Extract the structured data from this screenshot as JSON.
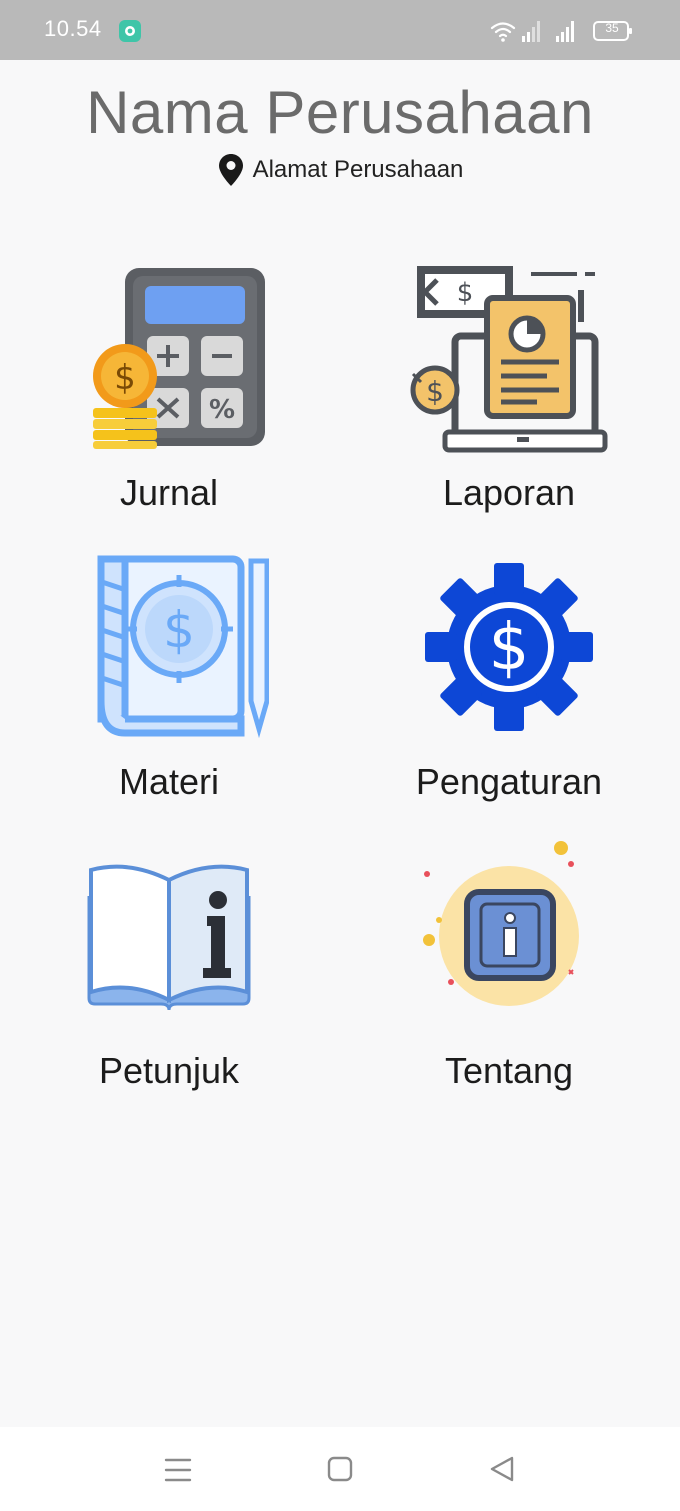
{
  "status_bar": {
    "time": "10.54",
    "battery": "35"
  },
  "header": {
    "company_name": "Nama Perusahaan",
    "company_address": "Alamat Perusahaan"
  },
  "menu": {
    "items": [
      {
        "label": "Jurnal",
        "icon": "calculator-coins-icon"
      },
      {
        "label": "Laporan",
        "icon": "report-laptop-icon"
      },
      {
        "label": "Materi",
        "icon": "money-book-icon"
      },
      {
        "label": "Pengaturan",
        "icon": "dollar-gear-icon"
      },
      {
        "label": "Petunjuk",
        "icon": "info-book-icon"
      },
      {
        "label": "Tentang",
        "icon": "info-badge-icon"
      }
    ]
  },
  "colors": {
    "status_bar": "#b9b9b9",
    "background": "#f8f8f9",
    "title_gray": "#6b6b6b",
    "gear_blue": "#0d47d6",
    "book_blue": "#6aa9f7"
  }
}
